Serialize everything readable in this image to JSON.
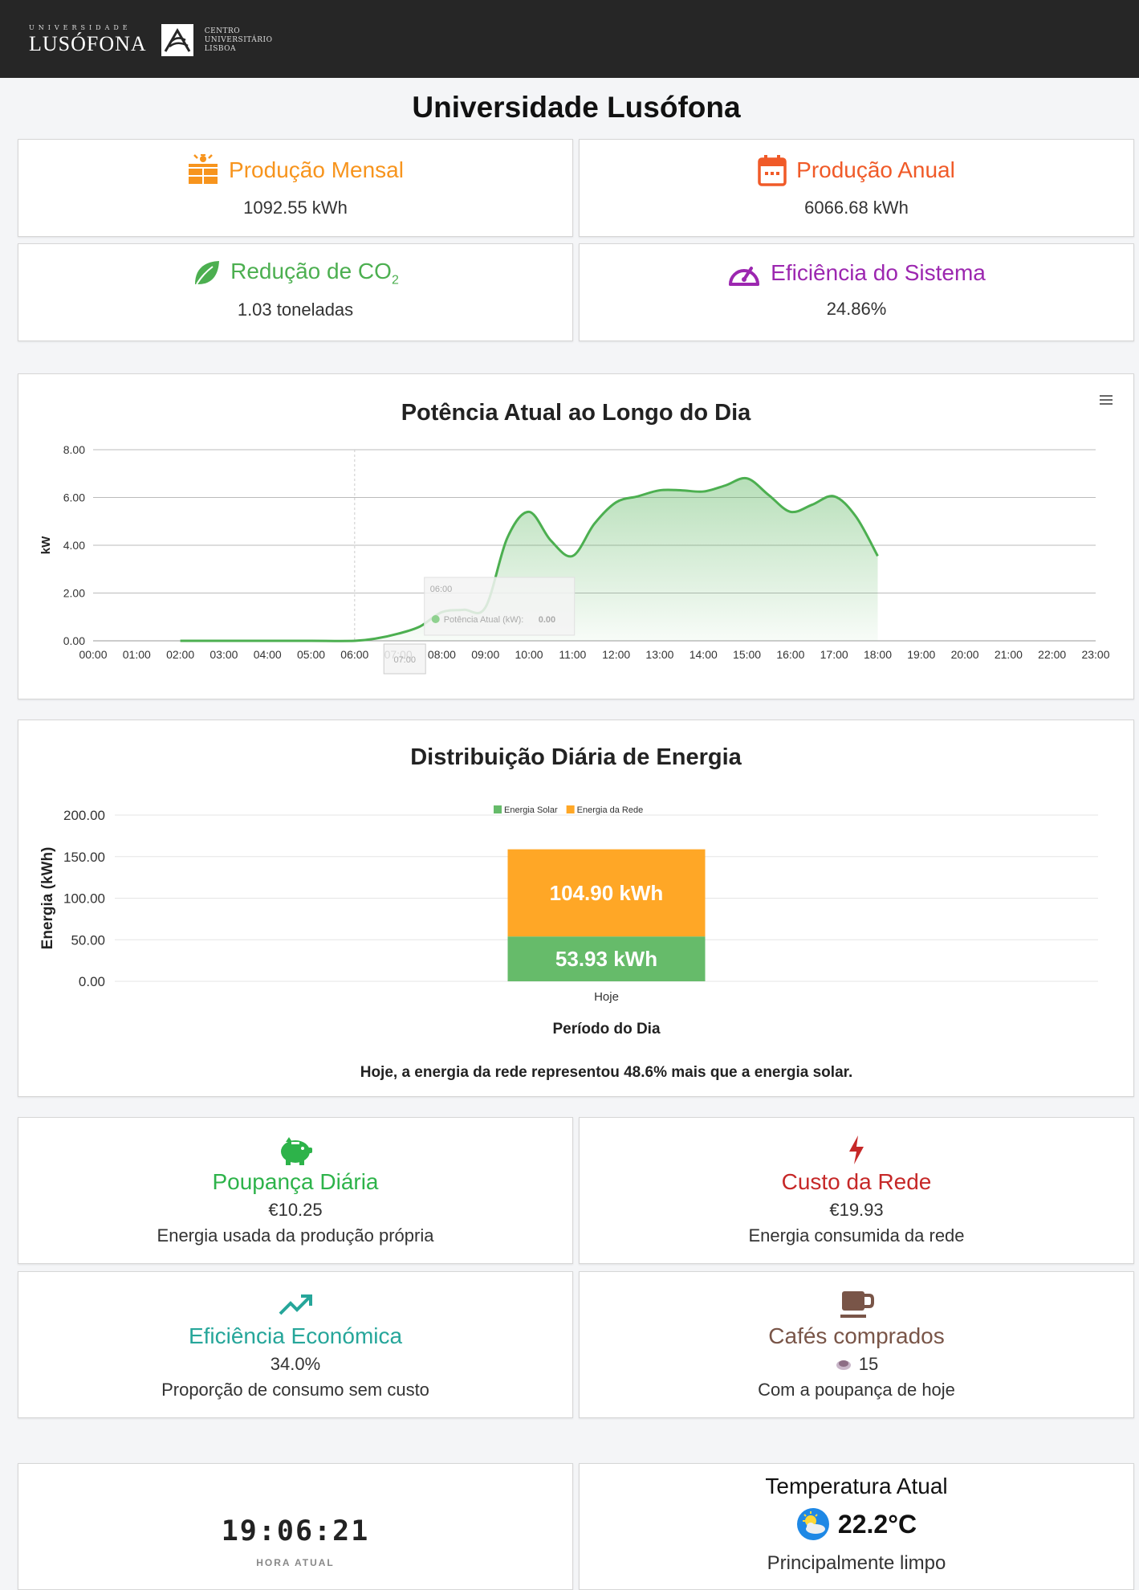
{
  "header": {
    "logo_small": "UNIVERSIDADE",
    "logo_big": "LUSÓFONA",
    "logo_right": [
      "CENTRO",
      "UNIVERSITÁRIO",
      "LISBOA"
    ]
  },
  "page_title": "Universidade Lusófona",
  "stats": [
    {
      "label": "Produção Mensal",
      "value": "1092.55 kWh",
      "color": "#f7941d",
      "icon": "solar-panel-icon"
    },
    {
      "label": "Produção Anual",
      "value": "6066.68 kWh",
      "color": "#f05a28",
      "icon": "calendar-icon"
    },
    {
      "label": "Redução de CO",
      "label_sub": "2",
      "value": "1.03 toneladas",
      "color": "#4caf50",
      "icon": "leaf-icon"
    },
    {
      "label": "Eficiência do Sistema",
      "value": "24.86%",
      "color": "#9c27b0",
      "icon": "gauge-icon"
    }
  ],
  "power_chart_title": "Potência Atual ao Longo do Dia",
  "distribution_chart_title": "Distribuição Diária de Energia",
  "chart_data": [
    {
      "type": "area",
      "title": "Potência Atual ao Longo do Dia",
      "ylabel": "kW",
      "xlabel": "",
      "ylim": [
        0,
        8
      ],
      "yticks": [
        "0.00",
        "2.00",
        "4.00",
        "6.00",
        "8.00"
      ],
      "x_ticks": [
        "00:00",
        "01:00",
        "02:00",
        "03:00",
        "04:00",
        "05:00",
        "06:00",
        "07:00",
        "08:00",
        "09:00",
        "10:00",
        "11:00",
        "12:00",
        "13:00",
        "14:00",
        "15:00",
        "16:00",
        "17:00",
        "18:00",
        "19:00",
        "20:00",
        "21:00",
        "22:00",
        "23:00"
      ],
      "series": [
        {
          "name": "Potência Atual (kW)",
          "color": "#4caf50",
          "x": [
            2,
            3,
            4,
            5,
            6,
            6.5,
            7,
            7.5,
            8,
            8.5,
            9,
            9.5,
            10,
            10.5,
            11,
            11.5,
            12,
            12.5,
            13,
            13.5,
            14,
            14.5,
            15,
            15.5,
            16,
            16.5,
            17,
            17.5,
            18
          ],
          "values": [
            0,
            0,
            0,
            0,
            0,
            0.1,
            0.3,
            0.6,
            1.2,
            1.3,
            1.4,
            4.3,
            5.4,
            4.2,
            3.55,
            4.9,
            5.8,
            6.05,
            6.3,
            6.3,
            6.25,
            6.5,
            6.8,
            6.1,
            5.4,
            5.7,
            6.05,
            5.2,
            3.55
          ]
        }
      ],
      "tooltip": {
        "title": "06:00",
        "series": "Potência Atual (kW):",
        "value": "0.00",
        "crosshair_label": "07:00"
      },
      "grid": true
    },
    {
      "type": "bar",
      "stacked": true,
      "title": "Distribuição Diária de Energia",
      "xlabel": "Período do Dia",
      "ylabel": "Energia (kWh)",
      "ylim": [
        0,
        200
      ],
      "yticks": [
        "0.00",
        "50.00",
        "100.00",
        "150.00",
        "200.00"
      ],
      "categories": [
        "Hoje"
      ],
      "series": [
        {
          "name": "Energia Solar",
          "values": [
            53.93
          ],
          "label": "53.93 kWh",
          "color": "#66bb6a"
        },
        {
          "name": "Energia da Rede",
          "values": [
            104.9
          ],
          "label": "104.90 kWh",
          "color": "#ffa726"
        }
      ],
      "legend": "top-center",
      "grid": true
    }
  ],
  "distribution_note": "Hoje, a energia da rede representou 48.6% mais que a energia solar.",
  "econ": [
    {
      "title": "Poupança Diária",
      "value": "€10.25",
      "sub": "Energia usada da produção própria",
      "color": "#2db34a",
      "icon": "piggy-bank-icon"
    },
    {
      "title": "Custo da Rede",
      "value": "€19.93",
      "sub": "Energia consumida da rede",
      "color": "#c62828",
      "icon": "lightning-icon"
    },
    {
      "title": "Eficiência Económica",
      "value": "34.0%",
      "sub": "Proporção de consumo sem custo",
      "color": "#26a69a",
      "icon": "trending-up-icon"
    },
    {
      "title": "Cafés comprados",
      "value": "15",
      "sub": "Com a poupança de hoje",
      "color": "#795548",
      "icon": "coffee-cup-icon"
    }
  ],
  "clock": {
    "time": "19:06:21",
    "label": "HORA ATUAL"
  },
  "weather": {
    "title": "Temperatura Atual",
    "value": "22.2°C",
    "desc": "Principalmente limpo",
    "icon": "partly-sunny-icon"
  }
}
